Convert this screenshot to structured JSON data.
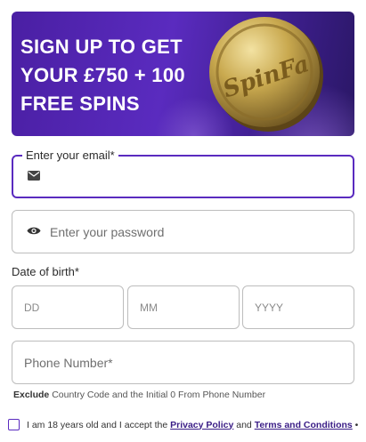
{
  "banner": {
    "line1": "SIGN UP TO GET",
    "line2": "YOUR £750 + 100",
    "line3": "FREE SPINS",
    "coin_text": "SpinFa",
    "colors": {
      "bg": "#4a1fa3",
      "coin": "#c9a94f",
      "text": "#ffffff"
    }
  },
  "email": {
    "label": "Enter your email*",
    "icon": "envelope-icon"
  },
  "password": {
    "placeholder": "Enter your password",
    "icon": "eye-icon"
  },
  "dob": {
    "label": "Date of birth*",
    "dd": "DD",
    "mm": "MM",
    "yyyy": "YYYY"
  },
  "phone": {
    "placeholder": "Phone Number*",
    "hint_bold": "Exclude",
    "hint_rest": " Country Code and the Initial 0 From Phone Number"
  },
  "consent": {
    "text_pre": "I am 18 years old and I accept the ",
    "privacy": "Privacy Policy",
    "and": " and ",
    "terms": "Terms and Conditions",
    "suffix": " •"
  },
  "accent_color": "#5a2bbf"
}
